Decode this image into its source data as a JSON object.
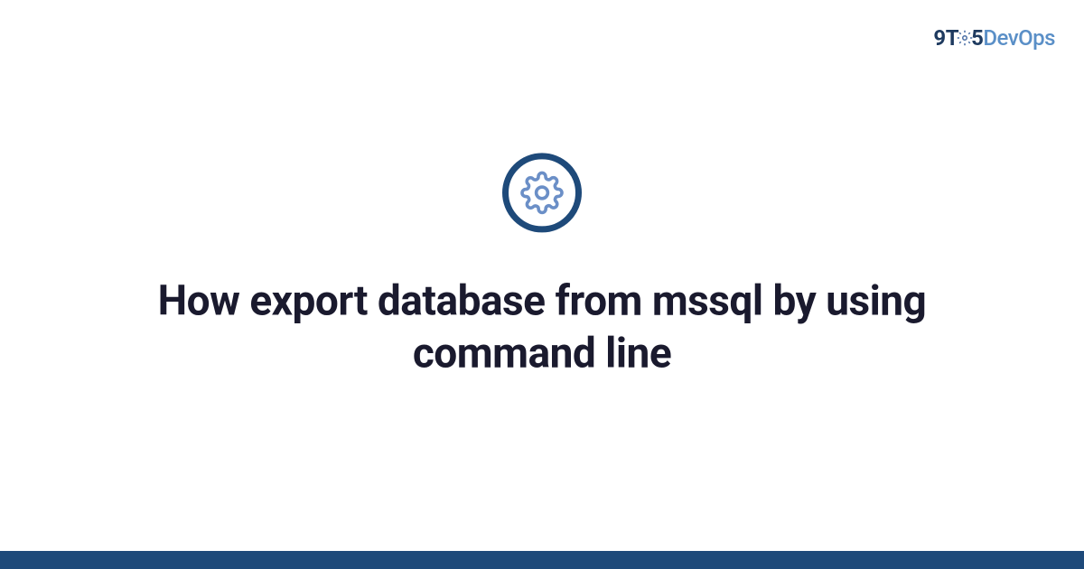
{
  "logo": {
    "prefix": "9T",
    "middle": "5",
    "suffix_dev": "Dev",
    "suffix_ops": "Ops"
  },
  "title": "How export database from mssql by using command line",
  "colors": {
    "brand_dark": "#1e4a7a",
    "brand_light": "#5a8fc7",
    "text_dark": "#1a1a2e"
  }
}
